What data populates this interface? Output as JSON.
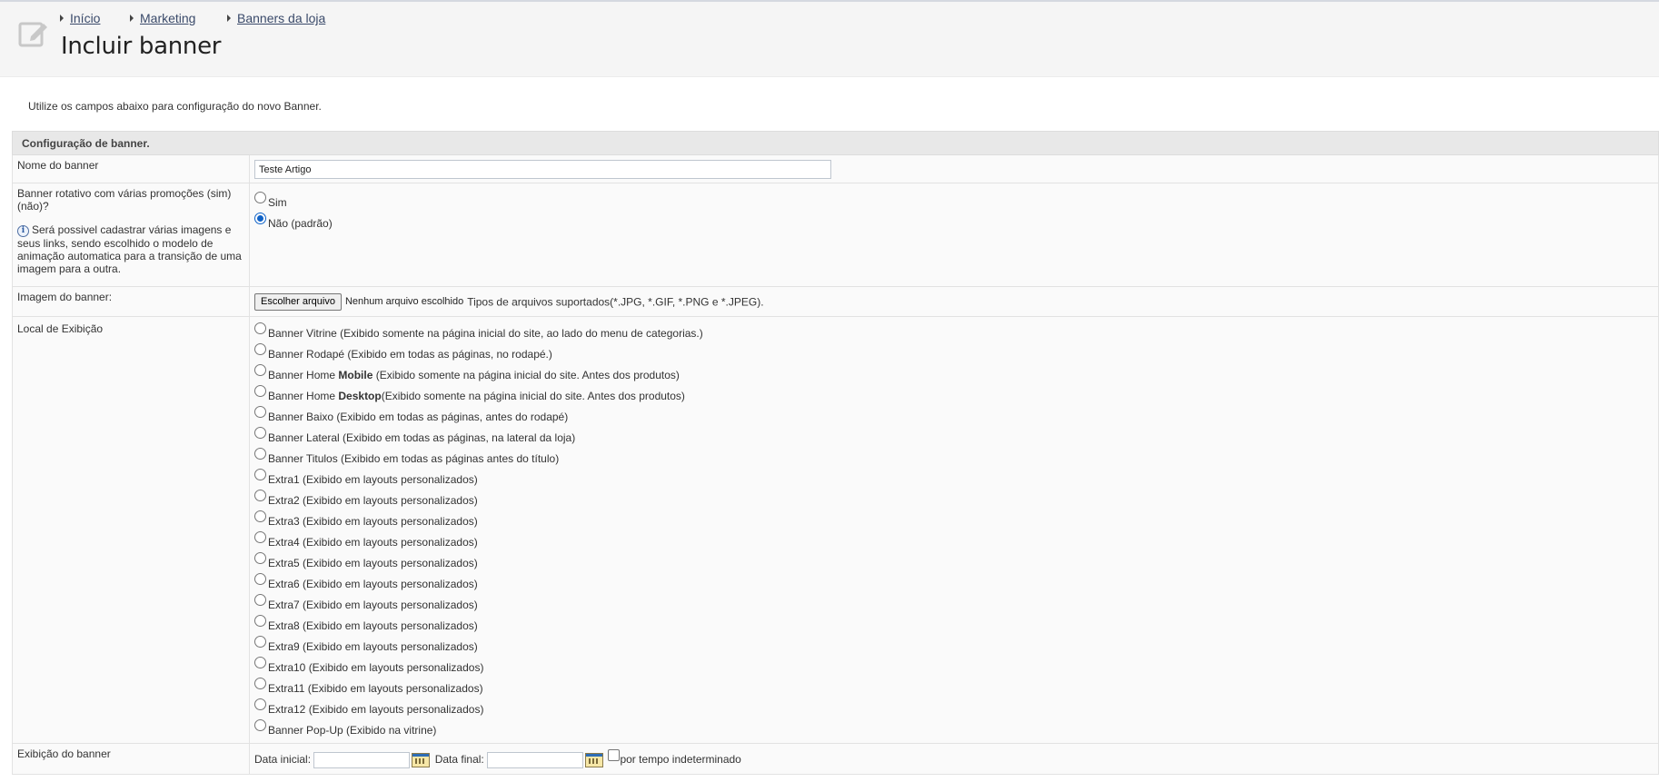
{
  "header": {
    "breadcrumb": [
      "Início",
      "Marketing",
      "Banners da loja"
    ],
    "title": "Incluir banner"
  },
  "intro": "Utilize os campos abaixo para configuração do novo Banner.",
  "section": {
    "title": "Configuração de banner."
  },
  "fields": {
    "name": {
      "label": "Nome do banner",
      "value": "Teste Artigo"
    },
    "rotating": {
      "label": "Banner rotativo com várias promoções (sim) (não)?",
      "note": "Será possivel cadastrar várias imagens e seus links, sendo escolhido o modelo de animação automatica para a transição de uma imagem para a outra.",
      "options": [
        "Sim",
        "Não (padrão)"
      ],
      "selected": "Não (padrão)"
    },
    "image": {
      "label": "Imagem do banner:",
      "button": "Escolher arquivo",
      "no_file": "Nenhum arquivo escolhido",
      "types": "Tipos de arquivos suportados(*.JPG, *.GIF, *.PNG e *.JPEG)."
    },
    "location": {
      "label": "Local de Exibição",
      "options": [
        {
          "pre": "Banner Vitrine (Exibido somente na página inicial do site, ao lado do menu de categorias.)",
          "bold": "",
          "post": ""
        },
        {
          "pre": "Banner Rodapé (Exibido em todas as páginas, no rodapé.)",
          "bold": "",
          "post": ""
        },
        {
          "pre": "Banner Home ",
          "bold": "Mobile",
          "post": " (Exibido somente na página inicial do site. Antes dos produtos)"
        },
        {
          "pre": "Banner Home ",
          "bold": "Desktop",
          "post": "(Exibido somente na página inicial do site. Antes dos produtos)"
        },
        {
          "pre": "Banner Baixo (Exibido em todas as páginas, antes do rodapé)",
          "bold": "",
          "post": ""
        },
        {
          "pre": "Banner Lateral (Exibido em todas as páginas, na lateral da loja)",
          "bold": "",
          "post": ""
        },
        {
          "pre": "Banner Titulos (Exibido em todas as páginas antes do título)",
          "bold": "",
          "post": ""
        },
        {
          "pre": "Extra1 (Exibido em layouts personalizados)",
          "bold": "",
          "post": ""
        },
        {
          "pre": "Extra2 (Exibido em layouts personalizados)",
          "bold": "",
          "post": ""
        },
        {
          "pre": "Extra3 (Exibido em layouts personalizados)",
          "bold": "",
          "post": ""
        },
        {
          "pre": "Extra4 (Exibido em layouts personalizados)",
          "bold": "",
          "post": ""
        },
        {
          "pre": "Extra5 (Exibido em layouts personalizados)",
          "bold": "",
          "post": ""
        },
        {
          "pre": "Extra6 (Exibido em layouts personalizados)",
          "bold": "",
          "post": ""
        },
        {
          "pre": "Extra7 (Exibido em layouts personalizados)",
          "bold": "",
          "post": ""
        },
        {
          "pre": "Extra8 (Exibido em layouts personalizados)",
          "bold": "",
          "post": ""
        },
        {
          "pre": "Extra9 (Exibido em layouts personalizados)",
          "bold": "",
          "post": ""
        },
        {
          "pre": "Extra10 (Exibido em layouts personalizados)",
          "bold": "",
          "post": ""
        },
        {
          "pre": "Extra11 (Exibido em layouts personalizados)",
          "bold": "",
          "post": ""
        },
        {
          "pre": "Extra12 (Exibido em layouts personalizados)",
          "bold": "",
          "post": ""
        },
        {
          "pre": "Banner Pop-Up (Exibido na vitrine)",
          "bold": "",
          "post": ""
        }
      ]
    },
    "display": {
      "label": "Exibição do banner",
      "start_label": "Data inicial:",
      "start_value": "",
      "end_label": "Data final:",
      "end_value": "",
      "indefinite_label": "por tempo indeterminado"
    }
  }
}
